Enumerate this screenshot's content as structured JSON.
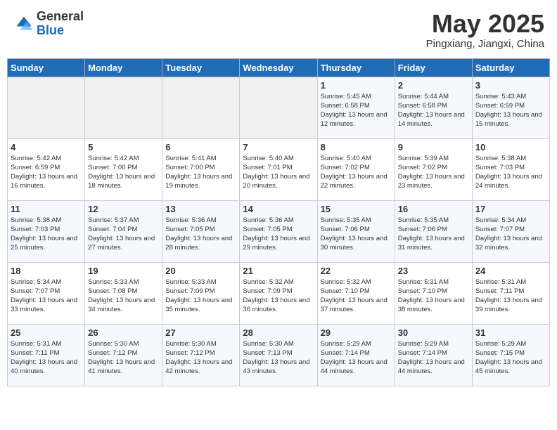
{
  "header": {
    "logo_general": "General",
    "logo_blue": "Blue",
    "month_title": "May 2025",
    "location": "Pingxiang, Jiangxi, China"
  },
  "weekdays": [
    "Sunday",
    "Monday",
    "Tuesday",
    "Wednesday",
    "Thursday",
    "Friday",
    "Saturday"
  ],
  "weeks": [
    [
      {
        "day": "",
        "info": ""
      },
      {
        "day": "",
        "info": ""
      },
      {
        "day": "",
        "info": ""
      },
      {
        "day": "",
        "info": ""
      },
      {
        "day": "1",
        "info": "Sunrise: 5:45 AM\nSunset: 6:58 PM\nDaylight: 13 hours\nand 12 minutes."
      },
      {
        "day": "2",
        "info": "Sunrise: 5:44 AM\nSunset: 6:58 PM\nDaylight: 13 hours\nand 14 minutes."
      },
      {
        "day": "3",
        "info": "Sunrise: 5:43 AM\nSunset: 6:59 PM\nDaylight: 13 hours\nand 15 minutes."
      }
    ],
    [
      {
        "day": "4",
        "info": "Sunrise: 5:42 AM\nSunset: 6:59 PM\nDaylight: 13 hours\nand 16 minutes."
      },
      {
        "day": "5",
        "info": "Sunrise: 5:42 AM\nSunset: 7:00 PM\nDaylight: 13 hours\nand 18 minutes."
      },
      {
        "day": "6",
        "info": "Sunrise: 5:41 AM\nSunset: 7:00 PM\nDaylight: 13 hours\nand 19 minutes."
      },
      {
        "day": "7",
        "info": "Sunrise: 5:40 AM\nSunset: 7:01 PM\nDaylight: 13 hours\nand 20 minutes."
      },
      {
        "day": "8",
        "info": "Sunrise: 5:40 AM\nSunset: 7:02 PM\nDaylight: 13 hours\nand 22 minutes."
      },
      {
        "day": "9",
        "info": "Sunrise: 5:39 AM\nSunset: 7:02 PM\nDaylight: 13 hours\nand 23 minutes."
      },
      {
        "day": "10",
        "info": "Sunrise: 5:38 AM\nSunset: 7:03 PM\nDaylight: 13 hours\nand 24 minutes."
      }
    ],
    [
      {
        "day": "11",
        "info": "Sunrise: 5:38 AM\nSunset: 7:03 PM\nDaylight: 13 hours\nand 25 minutes."
      },
      {
        "day": "12",
        "info": "Sunrise: 5:37 AM\nSunset: 7:04 PM\nDaylight: 13 hours\nand 27 minutes."
      },
      {
        "day": "13",
        "info": "Sunrise: 5:36 AM\nSunset: 7:05 PM\nDaylight: 13 hours\nand 28 minutes."
      },
      {
        "day": "14",
        "info": "Sunrise: 5:36 AM\nSunset: 7:05 PM\nDaylight: 13 hours\nand 29 minutes."
      },
      {
        "day": "15",
        "info": "Sunrise: 5:35 AM\nSunset: 7:06 PM\nDaylight: 13 hours\nand 30 minutes."
      },
      {
        "day": "16",
        "info": "Sunrise: 5:35 AM\nSunset: 7:06 PM\nDaylight: 13 hours\nand 31 minutes."
      },
      {
        "day": "17",
        "info": "Sunrise: 5:34 AM\nSunset: 7:07 PM\nDaylight: 13 hours\nand 32 minutes."
      }
    ],
    [
      {
        "day": "18",
        "info": "Sunrise: 5:34 AM\nSunset: 7:07 PM\nDaylight: 13 hours\nand 33 minutes."
      },
      {
        "day": "19",
        "info": "Sunrise: 5:33 AM\nSunset: 7:08 PM\nDaylight: 13 hours\nand 34 minutes."
      },
      {
        "day": "20",
        "info": "Sunrise: 5:33 AM\nSunset: 7:09 PM\nDaylight: 13 hours\nand 35 minutes."
      },
      {
        "day": "21",
        "info": "Sunrise: 5:32 AM\nSunset: 7:09 PM\nDaylight: 13 hours\nand 36 minutes."
      },
      {
        "day": "22",
        "info": "Sunrise: 5:32 AM\nSunset: 7:10 PM\nDaylight: 13 hours\nand 37 minutes."
      },
      {
        "day": "23",
        "info": "Sunrise: 5:31 AM\nSunset: 7:10 PM\nDaylight: 13 hours\nand 38 minutes."
      },
      {
        "day": "24",
        "info": "Sunrise: 5:31 AM\nSunset: 7:11 PM\nDaylight: 13 hours\nand 39 minutes."
      }
    ],
    [
      {
        "day": "25",
        "info": "Sunrise: 5:31 AM\nSunset: 7:11 PM\nDaylight: 13 hours\nand 40 minutes."
      },
      {
        "day": "26",
        "info": "Sunrise: 5:30 AM\nSunset: 7:12 PM\nDaylight: 13 hours\nand 41 minutes."
      },
      {
        "day": "27",
        "info": "Sunrise: 5:30 AM\nSunset: 7:12 PM\nDaylight: 13 hours\nand 42 minutes."
      },
      {
        "day": "28",
        "info": "Sunrise: 5:30 AM\nSunset: 7:13 PM\nDaylight: 13 hours\nand 43 minutes."
      },
      {
        "day": "29",
        "info": "Sunrise: 5:29 AM\nSunset: 7:14 PM\nDaylight: 13 hours\nand 44 minutes."
      },
      {
        "day": "30",
        "info": "Sunrise: 5:29 AM\nSunset: 7:14 PM\nDaylight: 13 hours\nand 44 minutes."
      },
      {
        "day": "31",
        "info": "Sunrise: 5:29 AM\nSunset: 7:15 PM\nDaylight: 13 hours\nand 45 minutes."
      }
    ]
  ]
}
